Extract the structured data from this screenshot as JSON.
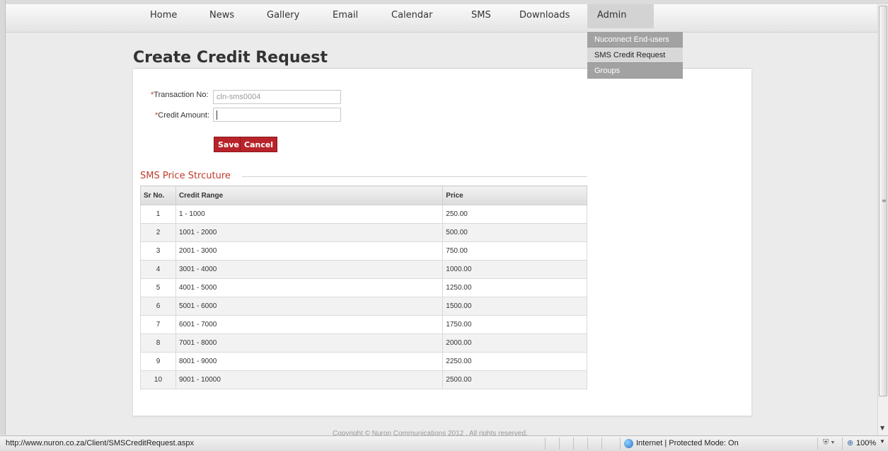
{
  "nav": {
    "items": [
      {
        "label": "Home"
      },
      {
        "label": "News"
      },
      {
        "label": "Gallery"
      },
      {
        "label": "Email"
      },
      {
        "label": "Calendar"
      },
      {
        "label": "SMS"
      },
      {
        "label": "Downloads"
      },
      {
        "label": "Admin",
        "active": true
      }
    ]
  },
  "admin_menu": {
    "items": [
      {
        "label": "Nuconnect End-users"
      },
      {
        "label": "SMS Credit Request",
        "highlighted": true
      },
      {
        "label": "Groups"
      }
    ]
  },
  "page": {
    "title": "Create Credit Request"
  },
  "form": {
    "required_marker": "*",
    "transaction_label": "Transaction No:",
    "transaction_value": "cln-sms0004",
    "credit_label": "Credit Amount:",
    "credit_value": "",
    "save_label": "Save",
    "cancel_label": "Cancel"
  },
  "price_structure": {
    "title": "SMS Price Strcuture",
    "columns": [
      "Sr No.",
      "Credit Range",
      "Price"
    ],
    "rows": [
      {
        "sr": "1",
        "range": "1 - 1000",
        "price": "250.00"
      },
      {
        "sr": "2",
        "range": "1001 - 2000",
        "price": "500.00"
      },
      {
        "sr": "3",
        "range": "2001 - 3000",
        "price": "750.00"
      },
      {
        "sr": "4",
        "range": "3001 - 4000",
        "price": "1000.00"
      },
      {
        "sr": "5",
        "range": "4001 - 5000",
        "price": "1250.00"
      },
      {
        "sr": "6",
        "range": "5001 - 6000",
        "price": "1500.00"
      },
      {
        "sr": "7",
        "range": "6001 - 7000",
        "price": "1750.00"
      },
      {
        "sr": "8",
        "range": "7001 - 8000",
        "price": "2000.00"
      },
      {
        "sr": "9",
        "range": "8001 - 9000",
        "price": "2250.00"
      },
      {
        "sr": "10",
        "range": "9001 - 10000",
        "price": "2500.00"
      }
    ]
  },
  "footer": {
    "text": "Copyright © Nuron Communications 2012 . All rights reserved."
  },
  "statusbar": {
    "url": "http://www.nuron.co.za/Client/SMSCreditRequest.aspx",
    "zone": "Internet | Protected Mode: On",
    "zoom": "100%",
    "zone_icon": "globe-icon",
    "protect_icon": "shield-icon",
    "zoom_icon": "magnifier-icon"
  },
  "colors": {
    "accent": "#b8232a",
    "section_title": "#c0392b",
    "dropdown_bg": "#a2a2a2",
    "nav_active_bg": "#d3d3d3"
  }
}
